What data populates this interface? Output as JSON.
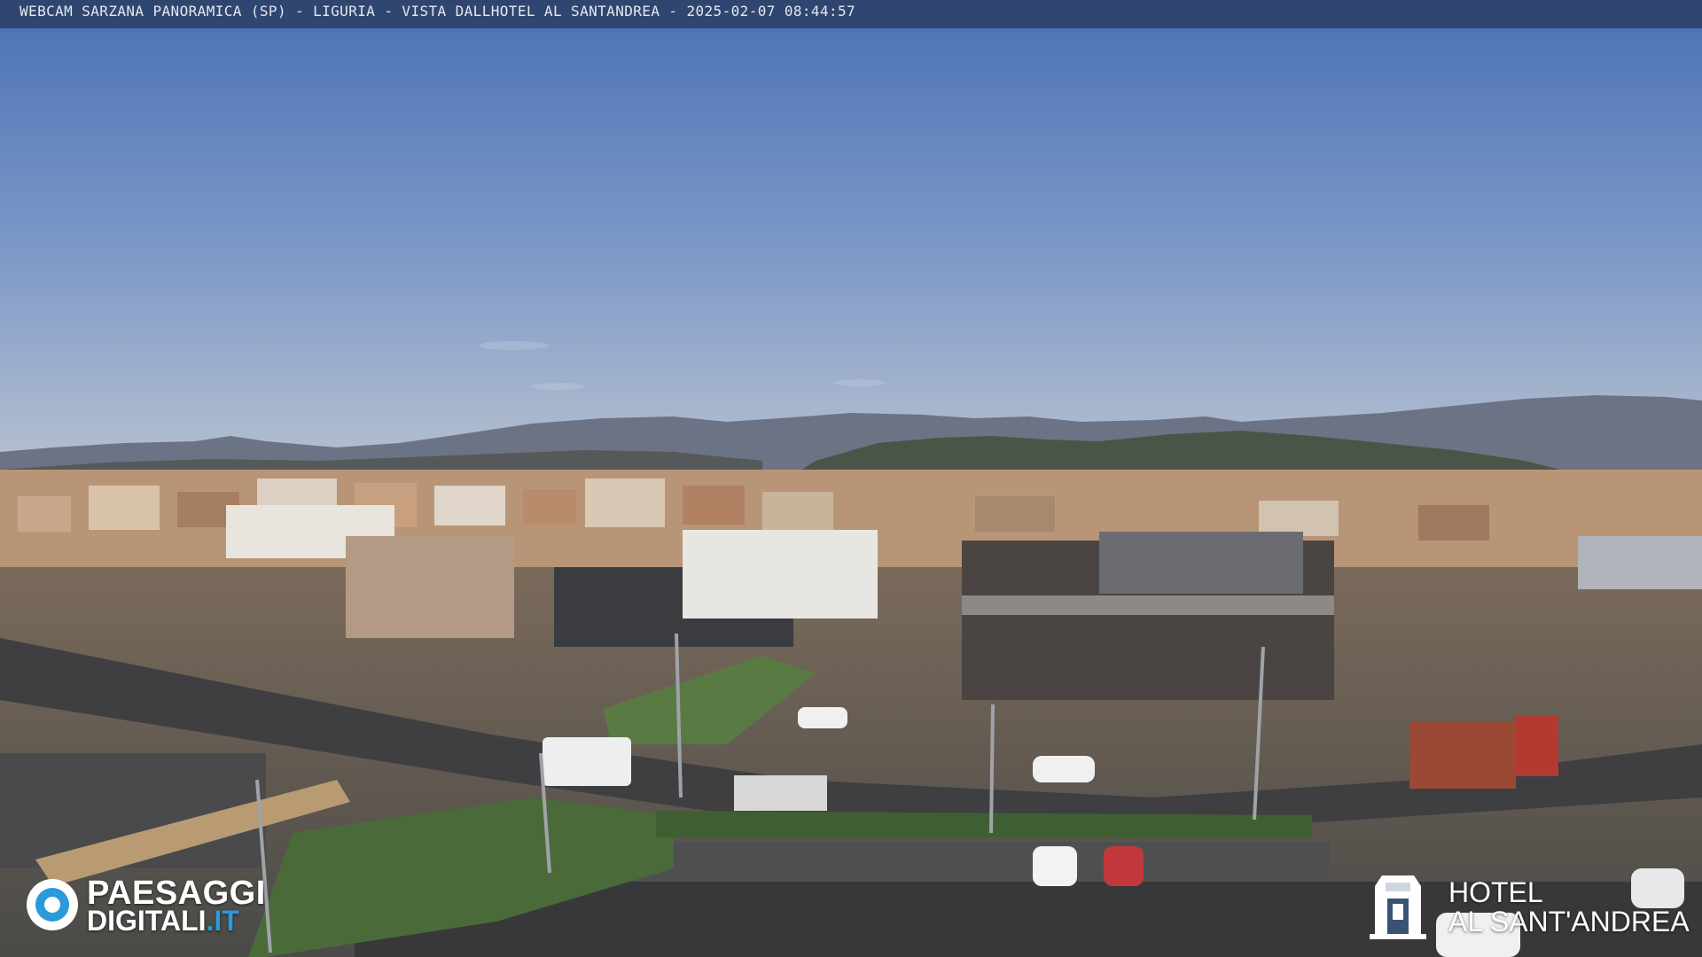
{
  "overlay": {
    "title": "WEBCAM SARZANA PANORAMICA (SP) - LIGURIA - VISTA DALLHOTEL AL SANTANDREA - 2025-02-07  08:44:57"
  },
  "logo_left": {
    "line1": "PAESAGGI",
    "line2_main": "DIGITALI",
    "line2_suffix": ".IT",
    "accent_color": "#2a9ad8"
  },
  "logo_right": {
    "line1": "HOTEL",
    "line2": "AL SANT'ANDREA",
    "icon": "hotel-building-icon"
  },
  "scene": {
    "sky_color": "#4f76b8",
    "mountain_color": "#4a5262",
    "ground_color": "#5a5a58"
  }
}
